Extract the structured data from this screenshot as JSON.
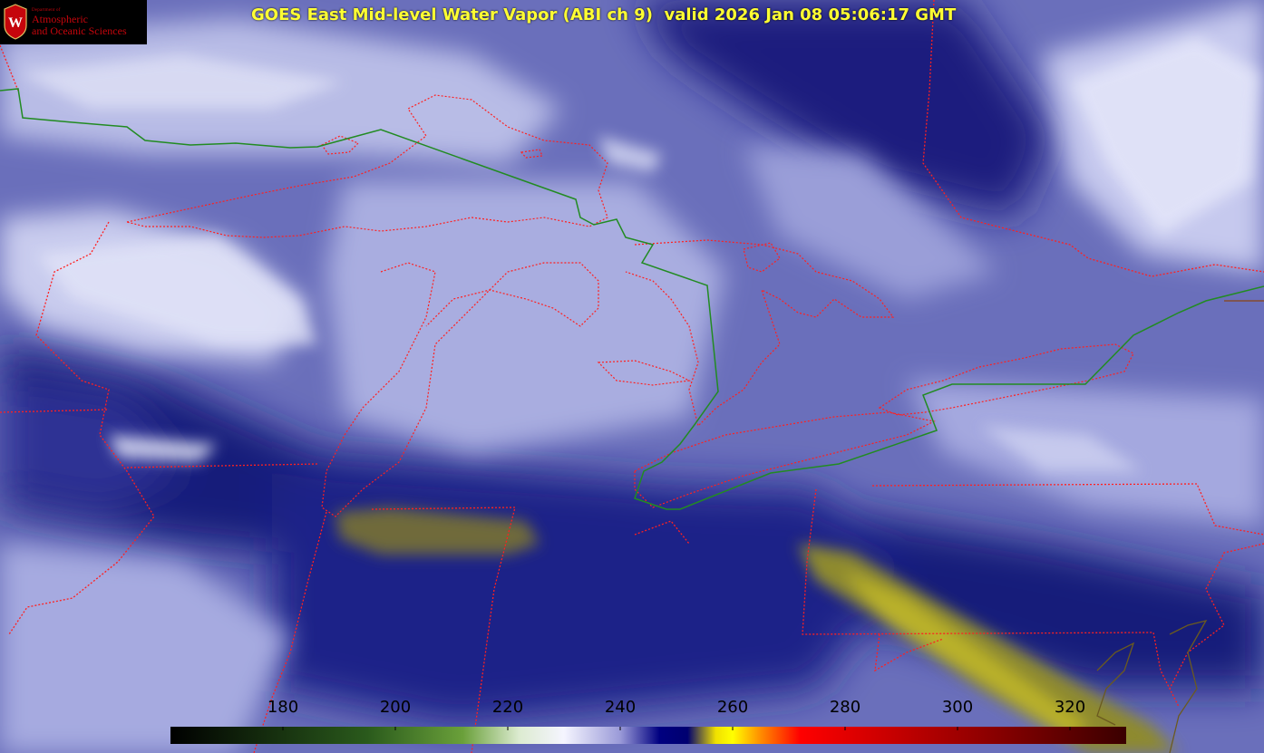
{
  "title": "GOES East Mid-level Water Vapor (ABI ch 9)  valid 2026 Jan 08 05:06:17 GMT",
  "logo": {
    "department": "Department of",
    "line1": "Atmospheric",
    "line2": "and Oceanic Sciences",
    "crest_letter": "W"
  },
  "colorbar": {
    "range": [
      160,
      330
    ],
    "tick_labels": [
      "180",
      "200",
      "220",
      "240",
      "260",
      "280",
      "300",
      "320"
    ],
    "tick_values": [
      180,
      200,
      220,
      240,
      260,
      280,
      300,
      320
    ],
    "stops": [
      {
        "value": 160,
        "color": "#000000"
      },
      {
        "value": 195,
        "color": "#2a5a1c"
      },
      {
        "value": 212,
        "color": "#6aa03a"
      },
      {
        "value": 222,
        "color": "#dcebd0"
      },
      {
        "value": 230,
        "color": "#f5f5ff"
      },
      {
        "value": 240,
        "color": "#9a9ad8"
      },
      {
        "value": 247,
        "color": "#000080"
      },
      {
        "value": 252,
        "color": "#000070"
      },
      {
        "value": 257,
        "color": "#f0e000"
      },
      {
        "value": 260,
        "color": "#ffff00"
      },
      {
        "value": 265,
        "color": "#ff8c00"
      },
      {
        "value": 272,
        "color": "#ff0000"
      },
      {
        "value": 295,
        "color": "#b00000"
      },
      {
        "value": 330,
        "color": "#3a0000"
      }
    ]
  },
  "colors": {
    "border_state": "#ff2020",
    "border_international": "#228b22",
    "coastline": "#8b4513"
  }
}
